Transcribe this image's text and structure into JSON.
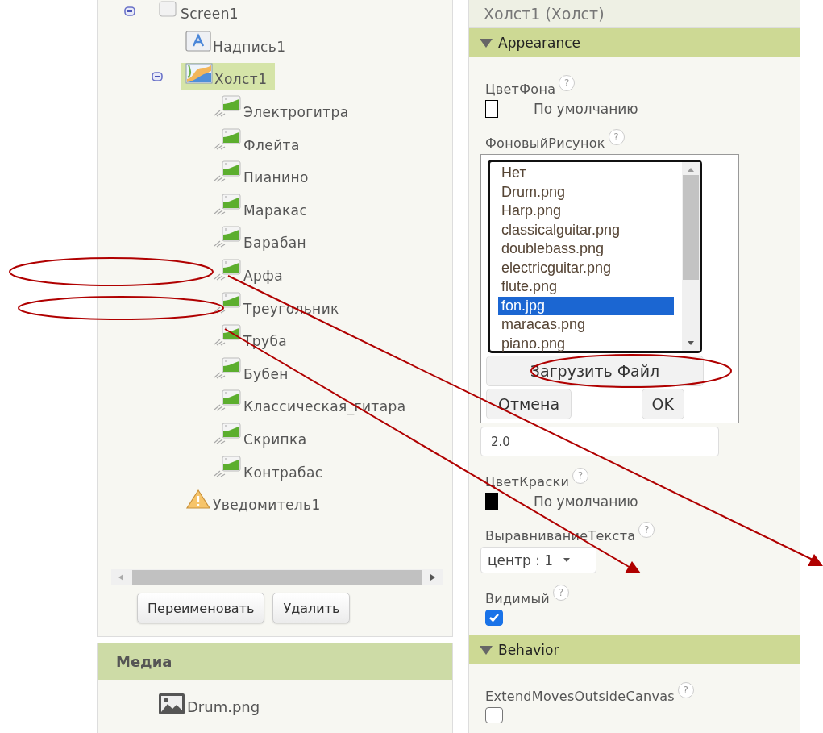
{
  "components": {
    "tree": [
      {
        "label": "Screen1",
        "kind": "screen",
        "expanded": true,
        "selected": false,
        "children": [
          {
            "label": "Надпись1",
            "kind": "label",
            "selected": false
          },
          {
            "label": "Холст1",
            "kind": "canvas",
            "expanded": true,
            "selected": true,
            "children": [
              {
                "label": "Электрогитра",
                "kind": "sprite",
                "selected": false
              },
              {
                "label": "Флейта",
                "kind": "sprite",
                "selected": false
              },
              {
                "label": "Пианино",
                "kind": "sprite",
                "selected": false
              },
              {
                "label": "Маракас",
                "kind": "sprite",
                "selected": false
              },
              {
                "label": "Барабан",
                "kind": "sprite",
                "selected": false
              },
              {
                "label": "Арфа",
                "kind": "sprite",
                "selected": false
              },
              {
                "label": "Треугольник",
                "kind": "sprite",
                "selected": false
              },
              {
                "label": "Труба",
                "kind": "sprite",
                "selected": false
              },
              {
                "label": "Бубен",
                "kind": "sprite",
                "selected": false
              },
              {
                "label": "Классическая_гитара",
                "kind": "sprite",
                "selected": false
              },
              {
                "label": "Скрипка",
                "kind": "sprite",
                "selected": false
              },
              {
                "label": "Контрабас",
                "kind": "sprite",
                "selected": false
              }
            ]
          },
          {
            "label": "Уведомитель1",
            "kind": "notifier",
            "selected": false
          }
        ]
      }
    ],
    "buttons": [
      "Переименовать",
      "Удалить"
    ]
  },
  "media": {
    "title": "Медиа",
    "items": [
      {
        "name": "Drum.png"
      }
    ]
  },
  "properties": {
    "header": "Холст1 (Холст)",
    "sections": [
      {
        "title": "Appearance",
        "expanded": true,
        "properties": [
          {
            "kind": "color",
            "label": "ЦветФона",
            "help": "?",
            "value": "По умолчанию",
            "color": "#ffffff"
          },
          {
            "kind": "asset",
            "label": "ФоновыйРисунок",
            "help": "?",
            "options": [
              {
                "label": "Нет",
                "selected": false
              },
              {
                "label": "Drum.png",
                "selected": false
              },
              {
                "label": "Harp.png",
                "selected": false
              },
              {
                "label": "classicalguitar.png",
                "selected": false
              },
              {
                "label": "doublebass.png",
                "selected": false
              },
              {
                "label": "electricguitar.png",
                "selected": false
              },
              {
                "label": "flute.png",
                "selected": false
              },
              {
                "label": "fon.jpg",
                "selected": true
              },
              {
                "label": "maracas.png",
                "selected": false
              },
              {
                "label": "piano.png",
                "selected": false
              }
            ],
            "upload": "Загрузить Файл",
            "cancel": "Отмена",
            "ok": "OK"
          },
          {
            "kind": "text",
            "value": "2.0"
          },
          {
            "kind": "color",
            "label": "ЦветКраски",
            "help": "?",
            "value": "По умолчанию",
            "color": "#000000"
          },
          {
            "kind": "select",
            "label": "ВыравниваниеТекста",
            "help": "?",
            "value": "центр : 1"
          },
          {
            "kind": "checkbox",
            "label": "Видимый",
            "help": "?",
            "checked": true
          }
        ]
      },
      {
        "title": "Behavior",
        "expanded": true,
        "properties": [
          {
            "kind": "checkbox",
            "label": "ExtendMovesOutsideCanvas",
            "help": "?",
            "checked": false
          }
        ]
      }
    ]
  }
}
